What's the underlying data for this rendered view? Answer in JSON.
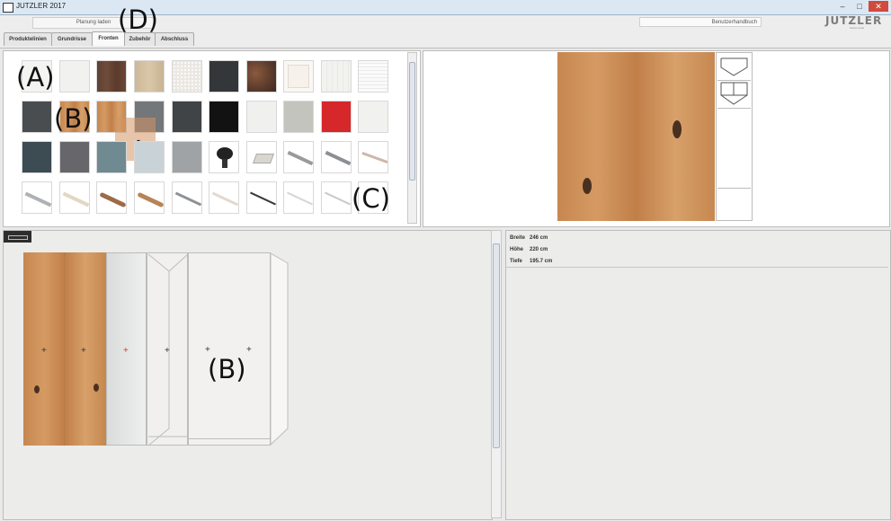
{
  "window": {
    "title": "JUTZLER 2017"
  },
  "toolbar": {
    "load_label": "Planung laden",
    "handbook_label": "Benutzerhandbuch",
    "logo": "JUTZLER",
    "logo_sub": "Swiss made"
  },
  "tabs": [
    {
      "label": "Produktelinien",
      "active": false
    },
    {
      "label": "Grundrisse",
      "active": false
    },
    {
      "label": "Fronten",
      "active": true
    },
    {
      "label": "Zubehör",
      "active": false
    },
    {
      "label": "Abschluss",
      "active": false
    }
  ],
  "annotations": {
    "a": "(A)",
    "b_top": "(B)",
    "c": "(C)",
    "d": "(D)",
    "b_bottom": "(B)"
  },
  "swatches": {
    "row1": [
      "white",
      "white",
      "walnut-dark",
      "oak-beige",
      "white-speckled",
      "anthracite",
      "rust-oxide",
      "cream-framed",
      "mint-plank",
      "white-slat"
    ],
    "row2": [
      "graphite",
      "oak-knotty",
      "oak-knotty",
      "grey",
      "anthracite",
      "black",
      "white",
      "light-grey",
      "red",
      "white"
    ],
    "row3": [
      "petrol",
      "slate-grey",
      "grey-blue",
      "light-grey-blue",
      "stone-grey",
      "knob-black",
      "handle-square-chrome",
      "handle-bar-chrome",
      "handle-bar-steel",
      "handle-bar-slim"
    ],
    "row4": [
      "handle-bow-chrome",
      "handle-bow-light",
      "handle-wood-dark",
      "handle-wood-light",
      "handle-bar-thin",
      "handle-bar-pale",
      "handle-bar-black",
      "handle-bar-white",
      "handle-bar-line",
      "handle-empty"
    ],
    "colors": {
      "red": "#d6272b",
      "black": "#151515",
      "anthracite": "#3b3e41",
      "petrol": "#3d4b53"
    }
  },
  "dimensions": {
    "width_label": "Breite",
    "width_value": "246 cm",
    "height_label": "Höhe",
    "height_value": "220 cm",
    "depth_label": "Tiefe",
    "depth_value": "195.7 cm"
  }
}
